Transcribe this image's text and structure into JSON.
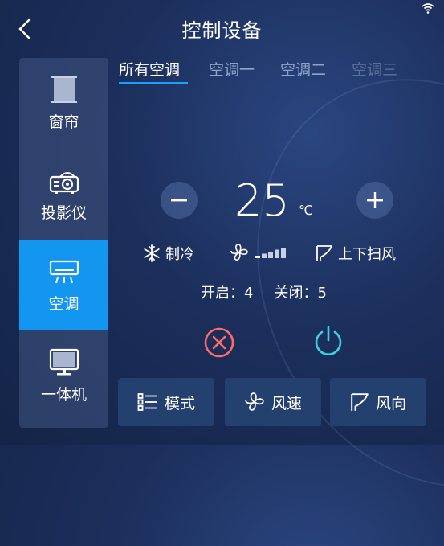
{
  "header": {
    "title": "控制设备"
  },
  "sidebar": {
    "items": [
      {
        "label": "窗帘",
        "icon": "curtain-icon"
      },
      {
        "label": "投影仪",
        "icon": "projector-icon"
      },
      {
        "label": "空调",
        "icon": "air-conditioner-icon",
        "active": true
      },
      {
        "label": "一体机",
        "icon": "monitor-icon"
      }
    ]
  },
  "tabs": [
    {
      "label": "所有空调",
      "active": true
    },
    {
      "label": "空调一"
    },
    {
      "label": "空调二"
    },
    {
      "label": "空调三"
    }
  ],
  "control": {
    "temperature": "25",
    "unit": "℃",
    "mode_label": "制冷",
    "swing_label": "上下扫风",
    "fan_level": 1,
    "fan_levels_total": 5
  },
  "counts": {
    "on": "开启：4",
    "off": "关闭：5"
  },
  "bottom_buttons": {
    "mode": "模式",
    "speed": "风速",
    "direction": "风向"
  },
  "colors": {
    "accent": "#1296f0",
    "off_red": "#ff6b6b",
    "power_cyan": "#3ed0e0"
  }
}
